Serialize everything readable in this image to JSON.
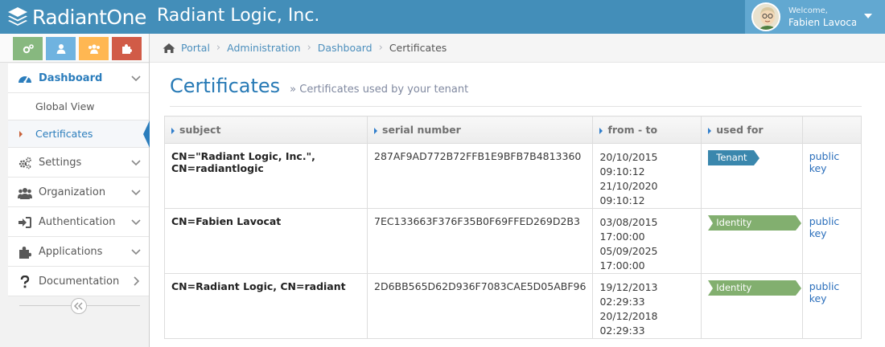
{
  "colors": {
    "navbar": "#438eb9",
    "user_box": "#62a8d1",
    "accent": "#2679b5",
    "tenant_label": "#3a87ad",
    "idp_label": "#82af6f",
    "shortcut_green": "#87b87f",
    "shortcut_blue": "#6fb3e0",
    "shortcut_orange": "#ffb752",
    "shortcut_red": "#d15b47"
  },
  "navbar": {
    "brand": "RadiantOne",
    "tenant": "Radiant Logic, Inc.",
    "welcome": "Welcome,",
    "user_name": "Fabien Lavocat"
  },
  "sidebar": {
    "shortcuts": [
      {
        "icon": "gears-icon",
        "color": "#87b87f"
      },
      {
        "icon": "user-icon",
        "color": "#6fb3e0"
      },
      {
        "icon": "users-icon",
        "color": "#ffb752"
      },
      {
        "icon": "puzzle-icon",
        "color": "#d15b47"
      }
    ],
    "items": [
      {
        "label": "Dashboard",
        "icon": "dashboard-icon",
        "expanded": true
      },
      {
        "label": "Settings",
        "icon": "gears-icon"
      },
      {
        "label": "Organization",
        "icon": "users-icon"
      },
      {
        "label": "Authentication",
        "icon": "sign-in-icon"
      },
      {
        "label": "Applications",
        "icon": "puzzle-icon"
      },
      {
        "label": "Documentation",
        "icon": "question-icon"
      }
    ],
    "submenu": [
      {
        "label": "Global View"
      },
      {
        "label": "Certificates",
        "current": true
      }
    ]
  },
  "breadcrumb": {
    "items": [
      "Portal",
      "Administration",
      "Dashboard"
    ],
    "current": "Certificates"
  },
  "page": {
    "title": "Certificates",
    "subtitle": "Certificates used by your tenant"
  },
  "table": {
    "headers": [
      "subject",
      "serial number",
      "from - to",
      "used for",
      ""
    ],
    "rows": [
      {
        "subject": "CN=\"Radiant Logic, Inc.\", CN=radiantlogic",
        "serial": "287AF9AD772B72FFB1E9BFB7B4813360",
        "from": "20/10/2015 09:10:12",
        "to": "21/10/2020 09:10:12",
        "used_for": "Tenant",
        "action": "public key"
      },
      {
        "subject": "CN=Fabien Lavocat",
        "serial": "7EC133663F376F35B0F69FFED269D2B3",
        "from": "03/08/2015 17:00:00",
        "to": "05/09/2025 17:00:00",
        "used_for": "Identity Provider",
        "action": "public key"
      },
      {
        "subject": "CN=Radiant Logic, CN=radiant",
        "serial": "2D6BB565D62D936F7083CAE5D05ABF96",
        "from": "19/12/2013 02:29:33",
        "to": "20/12/2018 02:29:33",
        "used_for": "Identity Provider",
        "action": "public key"
      }
    ]
  }
}
